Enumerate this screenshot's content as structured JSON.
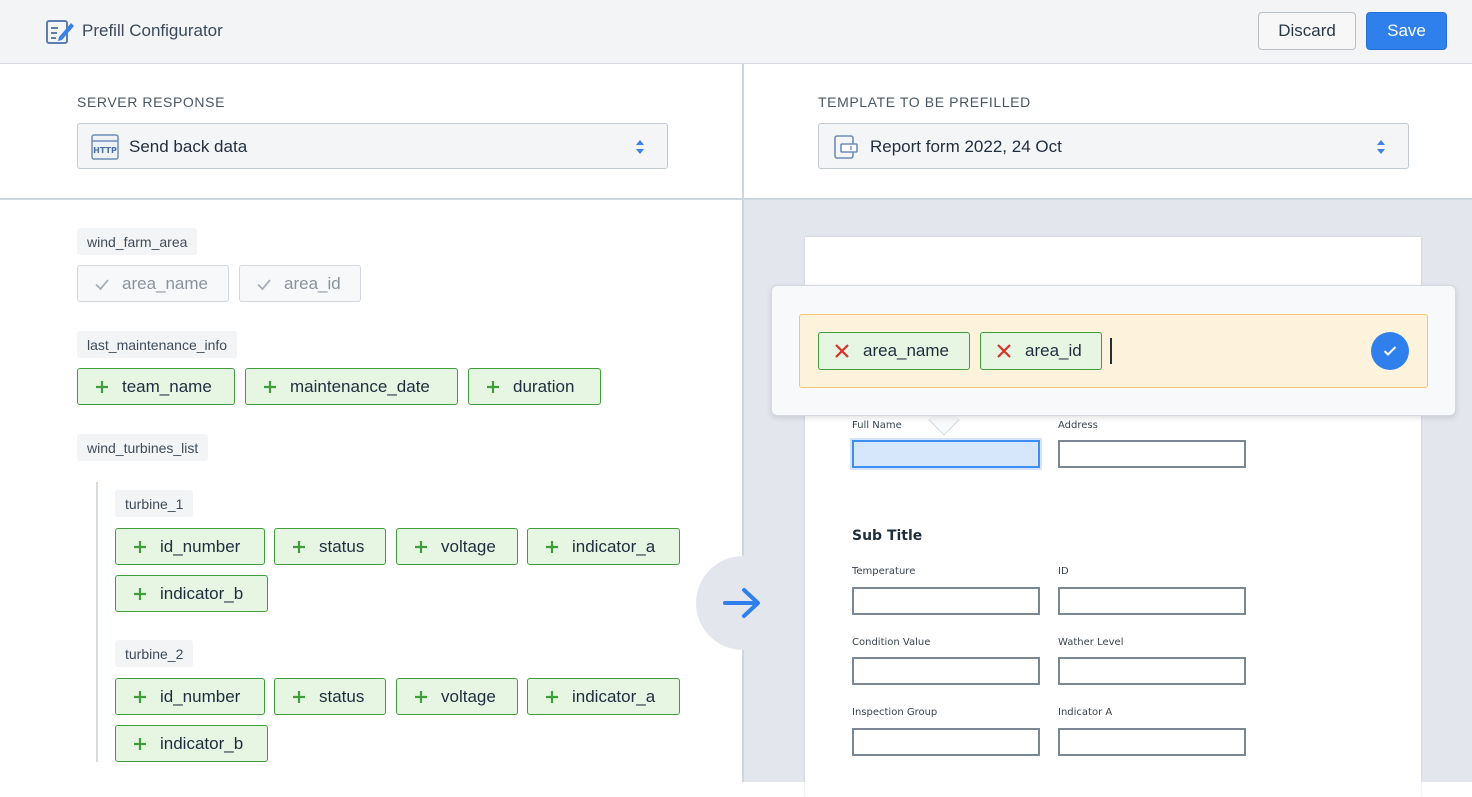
{
  "app": {
    "title": "Prefill Configurator",
    "icon": "edit-document-icon"
  },
  "toolbar": {
    "discard_label": "Discard",
    "save_label": "Save"
  },
  "server_response": {
    "label": "SERVER RESPONSE",
    "selected": "Send back data",
    "icon": "http-icon"
  },
  "template": {
    "label": "TEMPLATE TO BE PREFILLED",
    "selected": "Report form 2022, 24 Oct",
    "icon": "form-template-icon"
  },
  "groups": {
    "wind_farm_area": {
      "label": "wind_farm_area",
      "fields": [
        "area_name",
        "area_id"
      ]
    },
    "last_maintenance_info": {
      "label": "last_maintenance_info",
      "fields": [
        "team_name",
        "maintenance_date",
        "duration"
      ]
    },
    "wind_turbines_list": {
      "label": "wind_turbines_list",
      "turbine_1": {
        "label": "turbine_1",
        "fields": [
          "id_number",
          "status",
          "voltage",
          "indicator_a",
          "indicator_b"
        ]
      },
      "turbine_2": {
        "label": "turbine_2",
        "fields": [
          "id_number",
          "status",
          "voltage",
          "indicator_a",
          "indicator_b"
        ]
      }
    }
  },
  "mapping": {
    "chips": [
      "area_name",
      "area_id"
    ]
  },
  "form": {
    "sub_title": "Sub Title",
    "labels": {
      "full_name": "Full Name",
      "address": "Address",
      "temperature": "Temperature",
      "id": "ID",
      "condition_value": "Condition Value",
      "wather_level": "Wather Level",
      "inspection_group": "Inspection Group",
      "indicator_a": "Indicator A"
    }
  },
  "colors": {
    "accent": "#2f80ed",
    "success_border": "#3f9e3a",
    "success_bg": "#e6f6e3",
    "highlight_bg": "#fdf3dc",
    "highlight_border": "#f2c774",
    "remove": "#d93025"
  }
}
